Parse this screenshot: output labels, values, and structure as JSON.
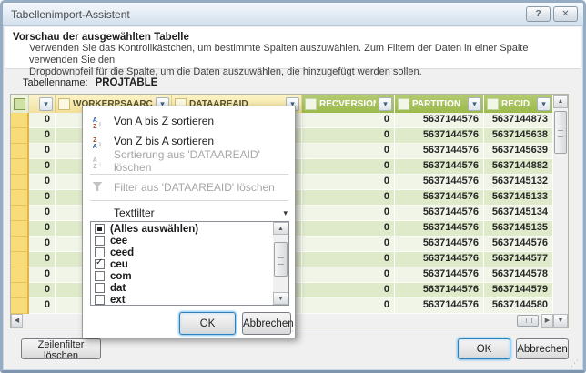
{
  "window": {
    "title": "Tabellenimport-Assistent",
    "help": "?",
    "close": "✕"
  },
  "intro": {
    "heading": "Vorschau der ausgewählten Tabelle",
    "line1": "Verwenden Sie das Kontrollkästchen, um bestimmte Spalten auszuwählen. Zum Filtern der Daten in einer Spalte verwenden Sie den",
    "line2": "Dropdownpfeil für die Spalte, um die Daten auszuwählen, die hinzugefügt werden sollen."
  },
  "table_name": {
    "label": "Tabellenname:",
    "value": "PROJTABLE"
  },
  "grid": {
    "columns": {
      "worker": {
        "label": "WORKERPSAARCHITECT"
      },
      "dataarea": {
        "label": "DATAAREAID"
      },
      "recversion": {
        "label": "RECVERSION"
      },
      "partition": {
        "label": "PARTITION"
      },
      "recid": {
        "label": "RECID"
      }
    },
    "rows": [
      {
        "col0": "0",
        "worker": "",
        "dataarea": "",
        "recversion": "0",
        "partition": "5637144576",
        "recid": "5637144873"
      },
      {
        "col0": "0",
        "worker": "",
        "dataarea": "",
        "recversion": "0",
        "partition": "5637144576",
        "recid": "5637145638"
      },
      {
        "col0": "0",
        "worker": "",
        "dataarea": "",
        "recversion": "0",
        "partition": "5637144576",
        "recid": "5637145639"
      },
      {
        "col0": "0",
        "worker": "",
        "dataarea": "",
        "recversion": "0",
        "partition": "5637144576",
        "recid": "5637144882"
      },
      {
        "col0": "0",
        "worker": "",
        "dataarea": "",
        "recversion": "0",
        "partition": "5637144576",
        "recid": "5637145132"
      },
      {
        "col0": "0",
        "worker": "",
        "dataarea": "",
        "recversion": "0",
        "partition": "5637144576",
        "recid": "5637145133"
      },
      {
        "col0": "0",
        "worker": "",
        "dataarea": "",
        "recversion": "0",
        "partition": "5637144576",
        "recid": "5637145134"
      },
      {
        "col0": "0",
        "worker": "",
        "dataarea": "",
        "recversion": "0",
        "partition": "5637144576",
        "recid": "5637145135"
      },
      {
        "col0": "0",
        "worker": "",
        "dataarea": "",
        "recversion": "0",
        "partition": "5637144576",
        "recid": "5637144576"
      },
      {
        "col0": "0",
        "worker": "",
        "dataarea": "",
        "recversion": "0",
        "partition": "5637144576",
        "recid": "5637144577"
      },
      {
        "col0": "0",
        "worker": "",
        "dataarea": "",
        "recversion": "0",
        "partition": "5637144576",
        "recid": "5637144578"
      },
      {
        "col0": "0",
        "worker": "",
        "dataarea": "",
        "recversion": "0",
        "partition": "5637144576",
        "recid": "5637144579"
      },
      {
        "col0": "0",
        "worker": "",
        "dataarea": "",
        "recversion": "0",
        "partition": "5637144576",
        "recid": "5637144580"
      }
    ]
  },
  "filter_menu": {
    "sort_az": "Von A bis Z sortieren",
    "sort_za": "Von Z bis A sortieren",
    "clear_sort": "Sortierung aus 'DATAAREAID' löschen",
    "clear_filter": "Filter aus 'DATAAREAID' löschen",
    "text_filter": "Textfilter",
    "items": [
      {
        "label": "(Alles auswählen)",
        "state": "indeterminate"
      },
      {
        "label": "cee",
        "state": "unchecked"
      },
      {
        "label": "ceed",
        "state": "unchecked"
      },
      {
        "label": "ceu",
        "state": "checked"
      },
      {
        "label": "com",
        "state": "unchecked"
      },
      {
        "label": "dat",
        "state": "unchecked"
      },
      {
        "label": "ext",
        "state": "unchecked"
      }
    ],
    "ok": "OK",
    "cancel": "Abbrechen"
  },
  "footer": {
    "clear_row_filter": "Zeilenfilter löschen",
    "ok": "OK",
    "cancel": "Abbrechen"
  },
  "colors": {
    "header_green": "#9cba4b",
    "header_yellow": "#f2df97",
    "row_selector_yellow": "#f8dc7a",
    "row_light": "#f1f5e8",
    "row_dark": "#dfeacb",
    "focus_blue": "#2f81b9"
  }
}
